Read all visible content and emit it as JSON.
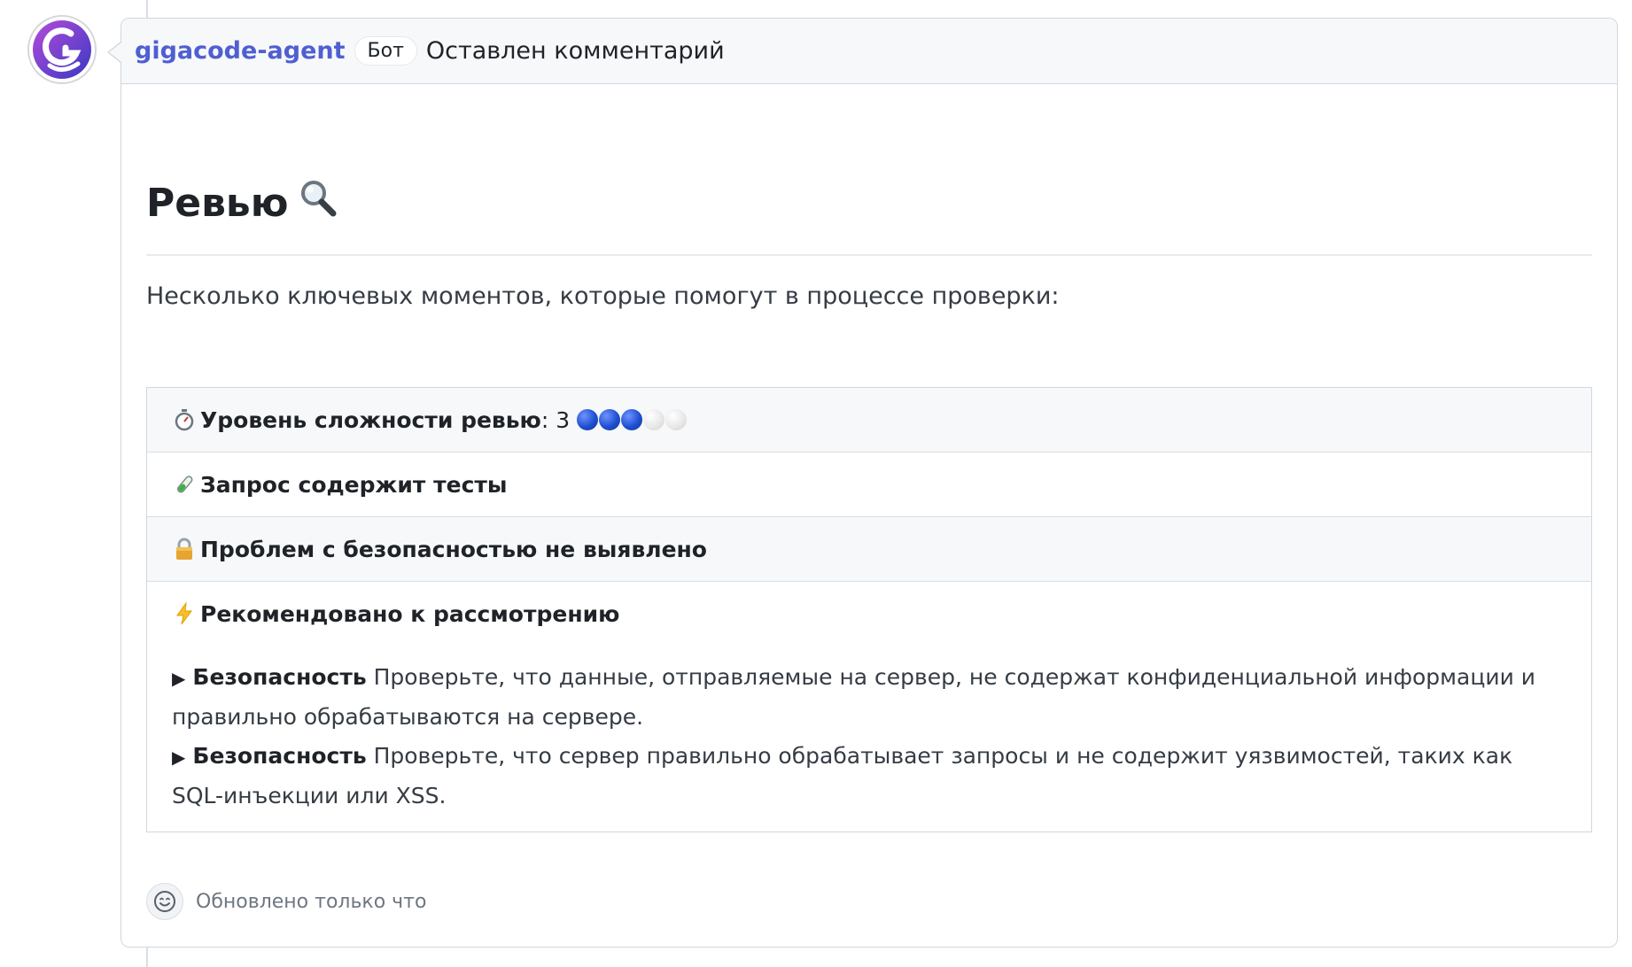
{
  "comment": {
    "author": "gigacode-agent",
    "badge": "Бот",
    "action": "Оставлен комментарий"
  },
  "review": {
    "title": "Ревью",
    "title_icon": "magnifier-icon",
    "intro": "Несколько ключевых моментов, которые помогут в процессе проверки:",
    "complexity": {
      "label": "Уровень сложности ревью",
      "suffix": ": 3",
      "value": 3,
      "max": 5
    },
    "rows": [
      {
        "icon": "test-tube-icon",
        "text": "Запрос содержит тесты"
      },
      {
        "icon": "lock-icon",
        "text": "Проблем с безопасностью не выявлено"
      },
      {
        "icon": "lightning-icon",
        "text": "Рекомендовано к рассмотрению"
      }
    ],
    "details": [
      {
        "title": "Безопасность",
        "text": "Проверьте, что данные, отправляемые на сервер, не содержат конфиденциальной информации и правильно обрабатываются на сервере."
      },
      {
        "title": "Безопасность",
        "text": "Проверьте, что сервер правильно обрабатывает запросы и не содержит уязвимостей, таких как SQL-инъекции или XSS."
      }
    ]
  },
  "footer": {
    "updated": "Обновлено только что",
    "reaction_icon": "smiley-icon"
  },
  "colors": {
    "author_link": "#4f5fd1",
    "header_bg": "#f6f8fa",
    "border": "#d0d7de",
    "dot_on": "#1f4fd1",
    "dot_off": "#e6e6e6"
  }
}
